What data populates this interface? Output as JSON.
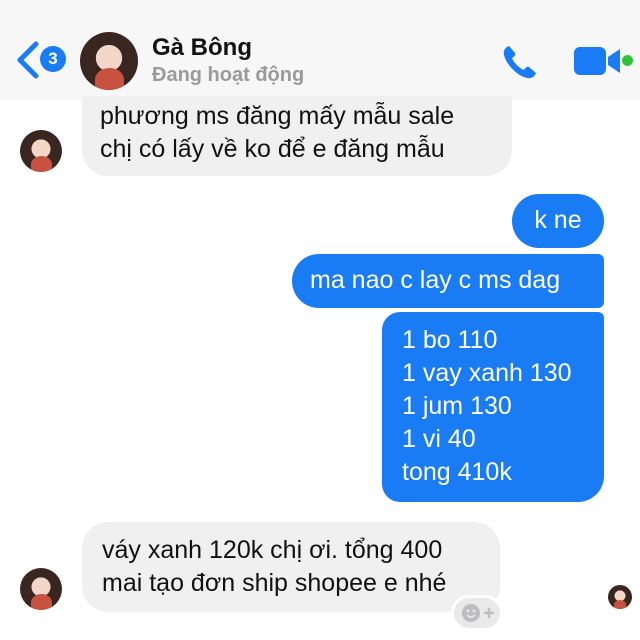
{
  "header": {
    "back_badge": "3",
    "contact_name": "Gà Bông",
    "status": "Đang hoạt động"
  },
  "messages": [
    {
      "from": "them",
      "lines": [
        "phương ms đăng mấy mẫu sale",
        "chị có lấy về ko để e đăng mẫu"
      ]
    },
    {
      "from": "me",
      "lines": [
        "k ne"
      ]
    },
    {
      "from": "me",
      "lines": [
        "ma nao c lay c ms dag"
      ]
    },
    {
      "from": "me",
      "lines": [
        "1 bo 110",
        "1 vay xanh 130",
        "1 jum 130",
        "1 vi 40",
        "tong 410k"
      ]
    },
    {
      "from": "them",
      "lines": [
        "váy xanh 120k chị ơi. tổng 400",
        "mai tạo đơn ship shopee e nhé"
      ]
    }
  ],
  "icons": {
    "back": "chevron-left-icon",
    "call": "phone-icon",
    "video": "video-camera-icon",
    "react": "add-reaction-icon"
  },
  "colors": {
    "accent": "#1a7cf5",
    "incoming_bubble": "#f1f0f0",
    "online": "#2fc33c",
    "status_text": "#9a9a9a"
  }
}
